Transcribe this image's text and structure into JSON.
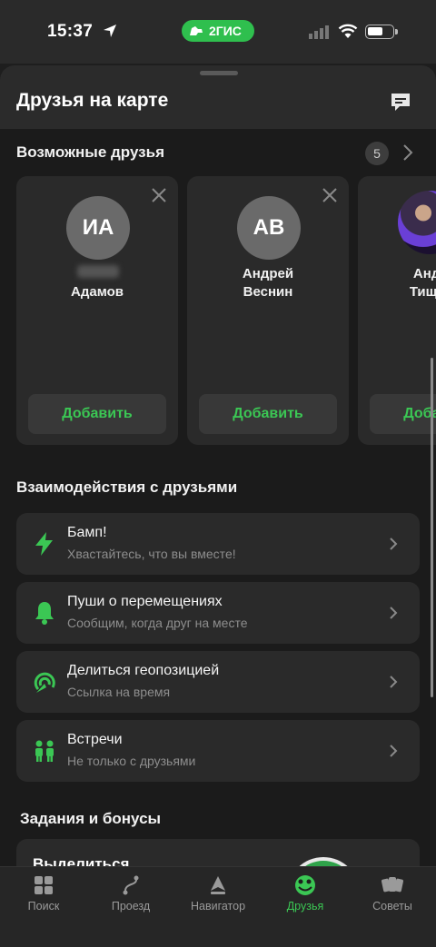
{
  "status_bar": {
    "time": "15:37",
    "app_badge": "2ГИС"
  },
  "header": {
    "title": "Друзья на карте"
  },
  "possible_friends": {
    "title": "Возможные друзья",
    "count": "5",
    "cards": [
      {
        "initials": "ИА",
        "name_line1": "",
        "name_line2": "Адамов",
        "add_label": "Добавить"
      },
      {
        "initials": "АВ",
        "name_line1": "Андрей",
        "name_line2": "Веснин",
        "add_label": "Добавить"
      },
      {
        "initials": "",
        "name_line1": "Андрей",
        "name_line2": "Тищенко",
        "add_label": "Добавить"
      }
    ]
  },
  "interactions": {
    "title": "Взаимодействия с друзьями",
    "items": [
      {
        "title": "Бамп!",
        "subtitle": "Хвастайтесь, что вы вместе!",
        "icon": "bolt-icon"
      },
      {
        "title": "Пуши о перемещениях",
        "subtitle": "Сообщим, когда друг на месте",
        "icon": "bell-icon"
      },
      {
        "title": "Делиться геопозицией",
        "subtitle": "Ссылка на время",
        "icon": "share-location-icon"
      },
      {
        "title": "Встречи",
        "subtitle": "Не только с друзьями",
        "icon": "people-icon"
      }
    ]
  },
  "tasks": {
    "title": "Задания и бонусы",
    "promo_title": "Выделиться"
  },
  "tabbar": {
    "items": [
      {
        "label": "Поиск",
        "icon": "grid-icon",
        "active": false
      },
      {
        "label": "Проезд",
        "icon": "route-icon",
        "active": false
      },
      {
        "label": "Навигатор",
        "icon": "navigator-icon",
        "active": false
      },
      {
        "label": "Друзья",
        "icon": "friends-icon",
        "active": true
      },
      {
        "label": "Советы",
        "icon": "cards-icon",
        "active": false
      }
    ]
  },
  "colors": {
    "accent": "#3bc754",
    "background": "#1b1b1b",
    "card": "#2a2a2a"
  }
}
